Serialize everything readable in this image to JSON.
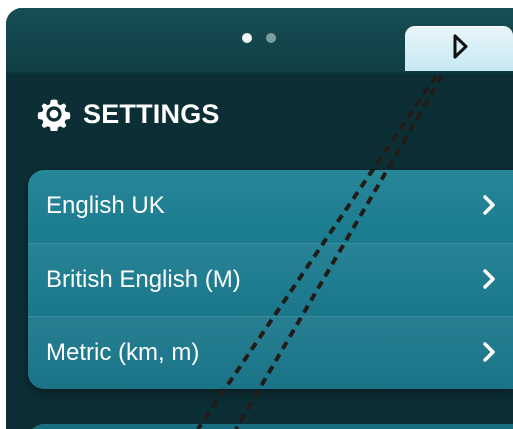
{
  "header": {
    "page_indicator": {
      "current": 1,
      "total": 2
    },
    "next_icon": "play-outline-icon"
  },
  "settings": {
    "title": "SETTINGS",
    "icon": "gear-icon",
    "items": [
      {
        "label": "English UK",
        "icon": "chevron-right-icon"
      },
      {
        "label": "British English (M)",
        "icon": "chevron-right-icon"
      },
      {
        "label": "Metric (km, m)",
        "icon": "chevron-right-icon"
      }
    ]
  },
  "colors": {
    "panel": "#0b2f35",
    "list": "#1a7f92",
    "tab": "#d9f1f8",
    "text": "#ffffff",
    "dash": "#231b16"
  }
}
